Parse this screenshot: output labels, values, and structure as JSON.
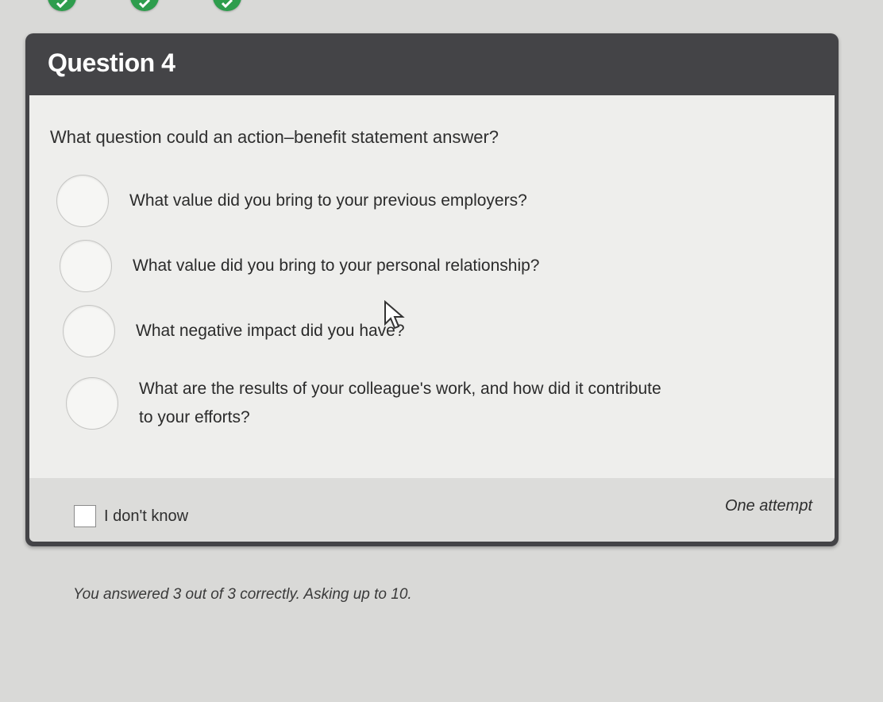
{
  "colors": {
    "header_bg": "#444447",
    "body_bg": "#eeeeec",
    "footer_bg": "#dcdcda",
    "progress_green": "#2e9d4d"
  },
  "progress": {
    "completed_icons": [
      "checkmark-icon",
      "checkmark-icon",
      "checkmark-icon"
    ]
  },
  "question": {
    "title": "Question 4",
    "prompt": "What question could an action–benefit statement answer?",
    "options": [
      "What value did you bring to your previous employers?",
      "What value did you bring to your personal relationship?",
      "What negative impact did you have?",
      "What are the results of your colleague's work, and how did it contribute to your efforts?"
    ]
  },
  "footer": {
    "dont_know_label": "I don't know",
    "attempt_label": "One attempt"
  },
  "score_text": "You answered 3 out of 3 correctly. Asking up to 10."
}
